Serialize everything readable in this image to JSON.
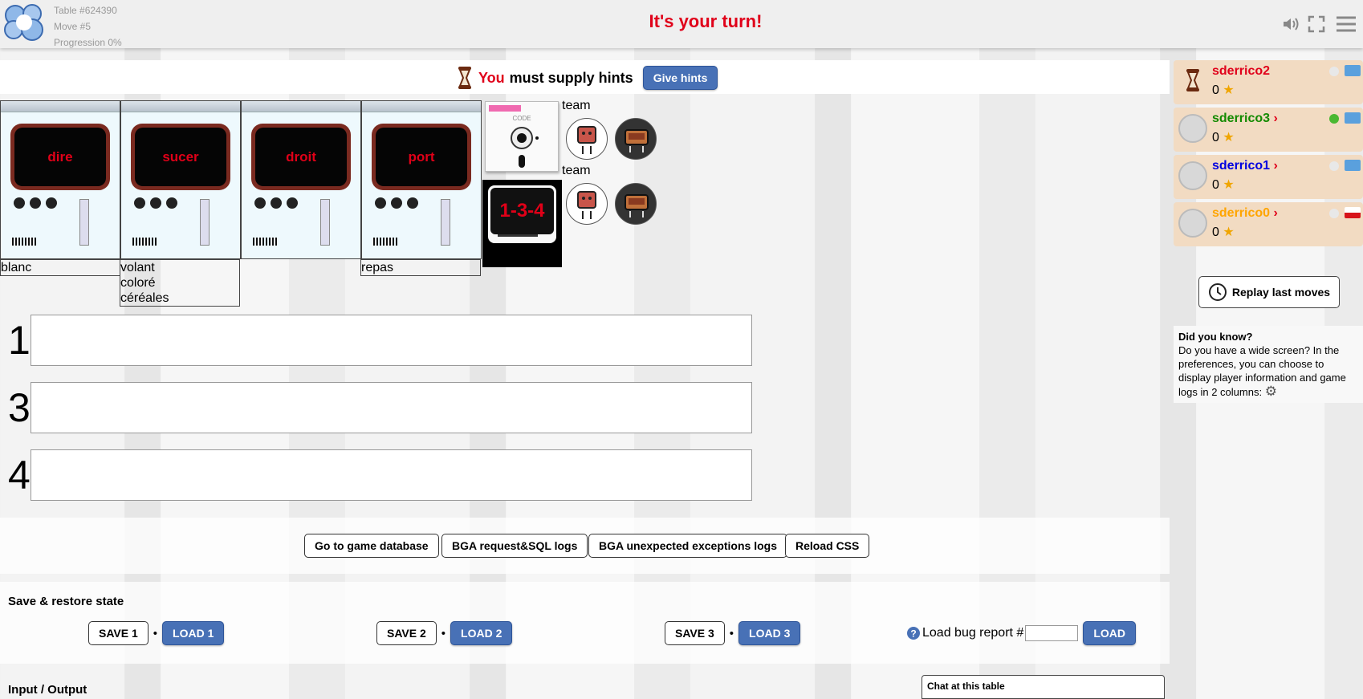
{
  "header": {
    "table": "Table #624390",
    "move": "Move #5",
    "progression": "Progression 0%",
    "turn_message": "It's your turn!"
  },
  "status": {
    "you": "You",
    "message": "must supply hints",
    "button": "Give hints"
  },
  "cards": [
    {
      "word": "dire",
      "clues": [
        "blanc"
      ]
    },
    {
      "word": "sucer",
      "clues": [
        "volant",
        "coloré",
        "céréales"
      ]
    },
    {
      "word": "droit",
      "clues": []
    },
    {
      "word": "port",
      "clues": [
        "repas"
      ]
    }
  ],
  "code_label": "CODE",
  "code": "1-3-4",
  "team_label": "team",
  "hint_rows": [
    "1",
    "3",
    "4"
  ],
  "admin_buttons": [
    "Go to game database",
    "BGA request&SQL logs",
    "BGA unexpected exceptions logs",
    "Reload CSS"
  ],
  "save": {
    "title": "Save & restore state",
    "save1": "SAVE 1",
    "load1": "LOAD 1",
    "save2": "SAVE 2",
    "load2": "LOAD 2",
    "save3": "SAVE 3",
    "load3": "LOAD 3",
    "sep": "•",
    "bug_label": "Load bug report #",
    "bug_value": "",
    "load": "LOAD"
  },
  "io_title": "Input / Output",
  "chat_title": "Chat at this table",
  "players": [
    {
      "name": "sderrico2",
      "score": "0",
      "color": "#e0001a",
      "flag": "un"
    },
    {
      "name": "sderrico3",
      "score": "0",
      "color": "#138a00",
      "flag": "un"
    },
    {
      "name": "sderrico1",
      "score": "0",
      "color": "#0000e0",
      "flag": "un"
    },
    {
      "name": "sderrico0",
      "score": "0",
      "color": "#ffa500",
      "flag": "cz"
    }
  ],
  "replay": "Replay last moves",
  "tip": {
    "title": "Did you know?",
    "text": "Do you have a wide screen? In the preferences, you can choose to display player information and game logs in 2 columns:"
  }
}
